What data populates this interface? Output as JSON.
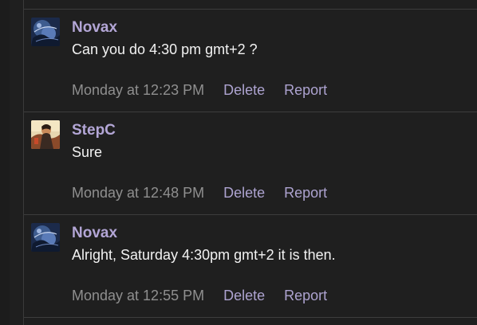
{
  "messages": [
    {
      "author": "Novax",
      "avatar_icon": "novax-avatar-icon",
      "text": "Can you do 4:30 pm gmt+2 ?",
      "timestamp": "Monday at 12:23 PM",
      "delete_label": "Delete",
      "report_label": "Report"
    },
    {
      "author": "StepC",
      "avatar_icon": "stepc-avatar-icon",
      "text": "Sure",
      "timestamp": "Monday at 12:48 PM",
      "delete_label": "Delete",
      "report_label": "Report"
    },
    {
      "author": "Novax",
      "avatar_icon": "novax-avatar-icon",
      "text": "Alright, Saturday 4:30pm gmt+2 it is then.",
      "timestamp": "Monday at 12:55 PM",
      "delete_label": "Delete",
      "report_label": "Report"
    }
  ],
  "colors": {
    "background": "#1f1f1f",
    "author": "#b3a6d6",
    "message_text": "#f2f2f2",
    "timestamp": "#8f8f8f",
    "action_link": "#ada3d0",
    "divider": "#3d3d3d"
  }
}
